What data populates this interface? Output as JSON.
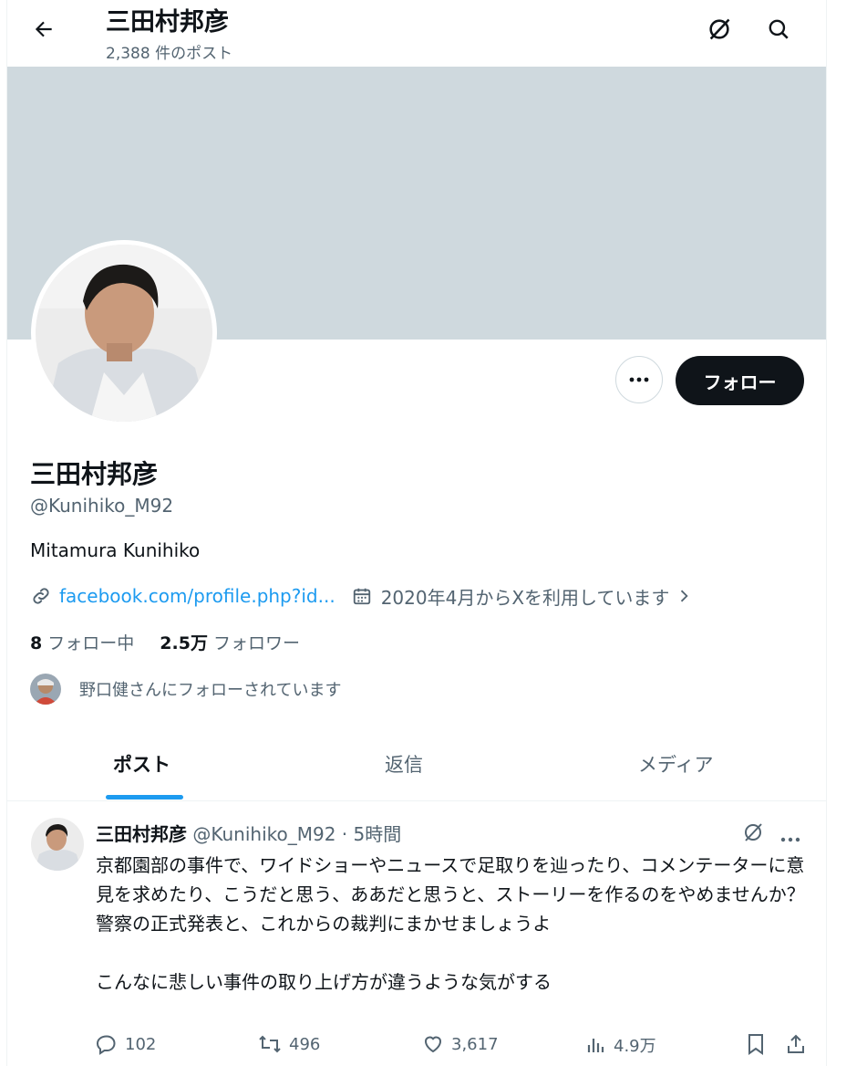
{
  "header": {
    "title": "三田村邦彦",
    "post_count": "2,388 件のポスト"
  },
  "profile": {
    "name": "三田村邦彦",
    "handle": "@Kunihiko_M92",
    "bio": "Mitamura Kunihiko",
    "link_text": "facebook.com/profile.php?id...",
    "joined_text": "2020年4月からXを利用しています",
    "following_count": "8",
    "following_label": "フォロー中",
    "followers_count": "2.5万",
    "followers_label": "フォロワー",
    "followed_by": "野口健さんにフォローされています",
    "follow_button": "フォロー"
  },
  "tabs": [
    {
      "label": "ポスト",
      "active": true
    },
    {
      "label": "返信",
      "active": false
    },
    {
      "label": "メディア",
      "active": false
    }
  ],
  "post": {
    "author_name": "三田村邦彦",
    "author_handle": "@Kunihiko_M92",
    "separator": "·",
    "time": "5時間",
    "text": "京都園部の事件で、ワイドショーやニュースで足取りを辿ったり、コメンテーターに意見を求めたり、こうだと思う、ああだと思うと、ストーリーを作るのをやめませんか？\n警察の正式発表と、これからの裁判にまかせましょうよ\n\nこんなに悲しい事件の取り上げ方が違うような気がする",
    "replies": "102",
    "reposts": "496",
    "likes": "3,617",
    "views": "4.9万"
  },
  "colors": {
    "accent": "#1d9bf0",
    "banner": "#cfd9de",
    "text_secondary": "#536471",
    "button_dark": "#0f1419"
  },
  "icons": [
    "back-arrow-icon",
    "grok-icon",
    "search-icon",
    "more-icon",
    "link-icon",
    "calendar-icon",
    "chevron-right-icon",
    "reply-icon",
    "repost-icon",
    "like-icon",
    "views-icon",
    "bookmark-icon",
    "share-icon"
  ]
}
